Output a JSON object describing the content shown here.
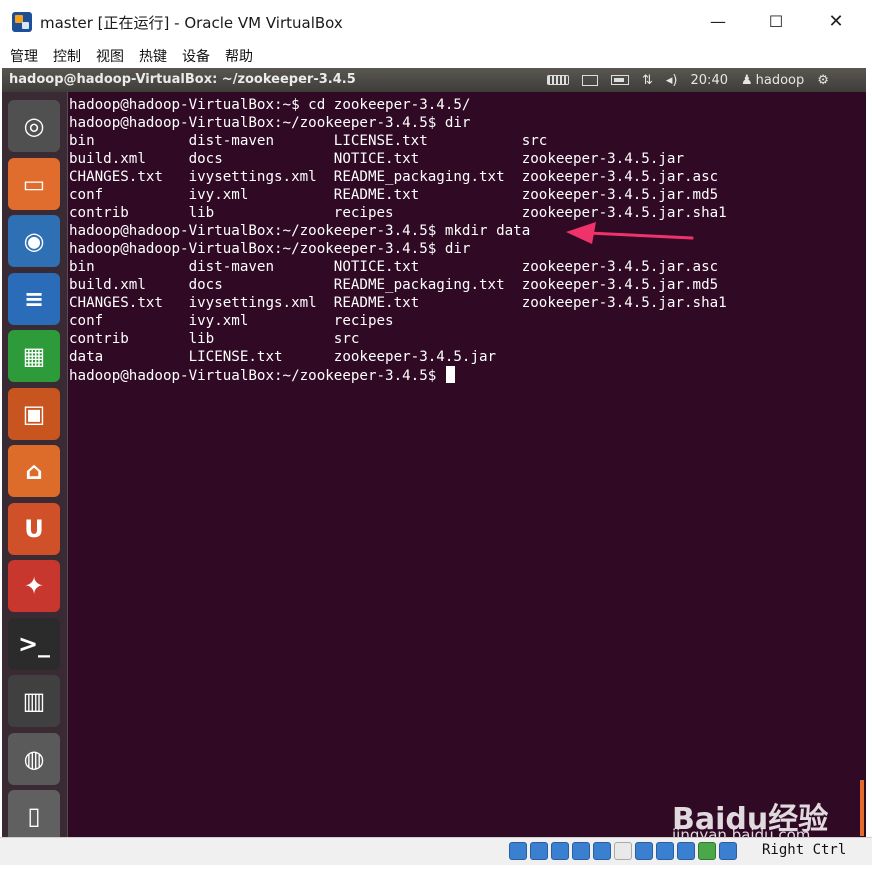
{
  "window": {
    "title": "master [正在运行] - Oracle VM VirtualBox",
    "minimize_glyph": "—",
    "maximize_glyph": "☐",
    "close_glyph": "✕"
  },
  "menu": [
    "管理",
    "控制",
    "视图",
    "热键",
    "设备",
    "帮助"
  ],
  "panel": {
    "title": "hadoop@hadoop-VirtualBox: ~/zookeeper-3.4.5",
    "time": "20:40",
    "user": "hadoop",
    "icons": [
      "keyboard-icon",
      "mail-icon",
      "battery-icon",
      "network-icon",
      "volume-icon",
      "user-icon",
      "gear-icon"
    ]
  },
  "launcher": [
    {
      "name": "dash-home",
      "glyph": "◎",
      "color": "#505050"
    },
    {
      "name": "files",
      "glyph": "▭",
      "color": "#e06c2d"
    },
    {
      "name": "firefox",
      "glyph": "◉",
      "color": "#2f6fb3"
    },
    {
      "name": "libreoffice-writer",
      "glyph": "≡",
      "color": "#2a6cb8"
    },
    {
      "name": "libreoffice-calc",
      "glyph": "▦",
      "color": "#2d9b3a"
    },
    {
      "name": "libreoffice-impress",
      "glyph": "▣",
      "color": "#c8551f"
    },
    {
      "name": "software-center",
      "glyph": "⌂",
      "color": "#dd6b2a"
    },
    {
      "name": "ubuntu-one",
      "glyph": "U",
      "color": "#d0502a"
    },
    {
      "name": "system-settings",
      "glyph": "✦",
      "color": "#c8372d"
    },
    {
      "name": "terminal",
      "glyph": ">_",
      "color": "#2b2b2b"
    },
    {
      "name": "workspace-switcher",
      "glyph": "▥",
      "color": "#404040"
    },
    {
      "name": "dvd-drive",
      "glyph": "◍",
      "color": "#5a5a5a"
    },
    {
      "name": "trash",
      "glyph": "▯",
      "color": "#606060"
    }
  ],
  "terminal": {
    "lines": [
      "hadoop@hadoop-VirtualBox:~$ cd zookeeper-3.4.5/",
      "hadoop@hadoop-VirtualBox:~/zookeeper-3.4.5$ dir",
      "bin           dist-maven       LICENSE.txt           src",
      "build.xml     docs             NOTICE.txt            zookeeper-3.4.5.jar",
      "CHANGES.txt   ivysettings.xml  README_packaging.txt  zookeeper-3.4.5.jar.asc",
      "conf          ivy.xml          README.txt            zookeeper-3.4.5.jar.md5",
      "contrib       lib              recipes               zookeeper-3.4.5.jar.sha1",
      "hadoop@hadoop-VirtualBox:~/zookeeper-3.4.5$ mkdir data",
      "hadoop@hadoop-VirtualBox:~/zookeeper-3.4.5$ dir",
      "bin           dist-maven       NOTICE.txt            zookeeper-3.4.5.jar.asc",
      "build.xml     docs             README_packaging.txt  zookeeper-3.4.5.jar.md5",
      "CHANGES.txt   ivysettings.xml  README.txt            zookeeper-3.4.5.jar.sha1",
      "conf          ivy.xml          recipes",
      "contrib       lib              src",
      "data          LICENSE.txt      zookeeper-3.4.5.jar",
      "hadoop@hadoop-VirtualBox:~/zookeeper-3.4.5$ "
    ],
    "annotation_arrow_color": "#f0326a"
  },
  "statusbar": {
    "host_key": "Right Ctrl"
  },
  "watermark": {
    "logo": "Baidu经验",
    "url": "jingyan.baidu.com"
  }
}
